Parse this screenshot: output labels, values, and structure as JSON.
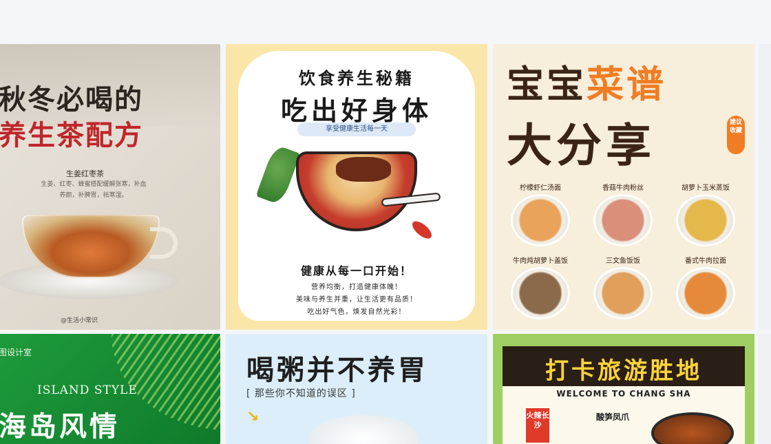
{
  "colors": {
    "background": "#f4f6f9",
    "tea_red": "#c0262a",
    "recipe_orange": "#f07d24",
    "travel_yellow": "#ffd43b"
  },
  "cards": {
    "tea": {
      "title_line1": "秋冬必喝的",
      "title_line2": "养生茶配方",
      "subtitle": "生姜红枣茶",
      "desc_line1": "生姜、红枣、蜂蜜搭配缓解张寒，补血",
      "desc_line2": "养颜，补脾胃，祛寒湿。",
      "credit": "@生活小常识"
    },
    "healthy_food": {
      "title_line1": "饮食养生秘籍",
      "title_line2": "吃出好身体",
      "pill": "享受健康生活每一天",
      "slogan": "健康从每一口开始！",
      "line1": "营养均衡，打造健康体魄！",
      "line2": "美味与养生并重，让生活更有品质！",
      "line3": "吃出好气色，焕发自然光彩！"
    },
    "baby_recipes": {
      "title_a_dark": "宝宝",
      "title_a_orange": "菜谱",
      "title_b": "大分享",
      "stamp": "建议收藏",
      "dishes": [
        {
          "label": "柠檬虾仁汤面",
          "color": "#e9a35a"
        },
        {
          "label": "香菇牛肉粉丝",
          "color": "#d98f7a"
        },
        {
          "label": "胡萝卜玉米蒸饭",
          "color": "#e4b84a"
        },
        {
          "label": "牛肉炖胡萝卜盖饭",
          "color": "#8a6a4a"
        },
        {
          "label": "三文鱼饭饭",
          "color": "#e0a05c"
        },
        {
          "label": "番式牛肉拉面",
          "color": "#e58a3a"
        }
      ]
    },
    "island": {
      "studio": "图设计室",
      "style": "ISLAND STYLE",
      "title": "海岛风情"
    },
    "porridge": {
      "title": "喝粥并不养胃",
      "bracket": "[ 那些你不知道的误区 ]",
      "arrow": "↘"
    },
    "travel": {
      "title": "打卡旅游胜地",
      "welcome": "WELCOME TO CHANG SHA",
      "tag": "火辣长沙",
      "dish": "酸笋凤爪"
    }
  }
}
